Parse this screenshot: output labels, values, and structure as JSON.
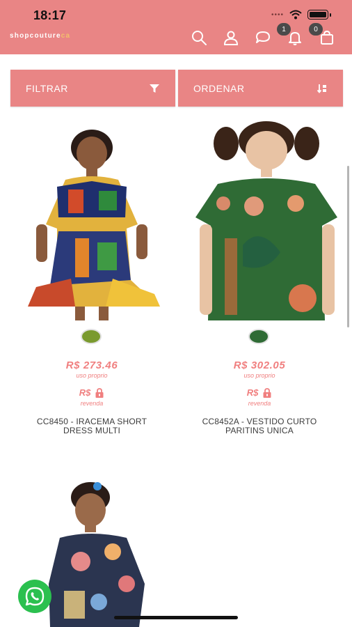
{
  "status_bar": {
    "time": "18:17",
    "signal_dots": "••••"
  },
  "header": {
    "logo_main": "shopcouture",
    "logo_accent": "ca",
    "notifications_count": "1",
    "cart_count": "0"
  },
  "toolbar": {
    "filter_label": "FILTRAR",
    "sort_label": "ORDENAR"
  },
  "products": [
    {
      "price": "R$ 273.46",
      "price_note": "uso proprio",
      "resale_price": "R$",
      "resale_note": "revenda",
      "name_line1": "CC8450 - IRACEMA SHORT",
      "name_line2": "DRESS MULTI",
      "swatch_color": "#7a9a2e"
    },
    {
      "price": "R$ 302.05",
      "price_note": "uso proprio",
      "resale_price": "R$",
      "resale_note": "revenda",
      "name_line1": "CC8452A - VESTIDO CURTO",
      "name_line2": "PARITINS UNICA",
      "swatch_color": "#2f6b35"
    },
    {
      "swatch_color": "#2b3550"
    }
  ],
  "colors": {
    "brand": "#e98585",
    "price": "#f07f7f",
    "whatsapp": "#2bc04f"
  }
}
